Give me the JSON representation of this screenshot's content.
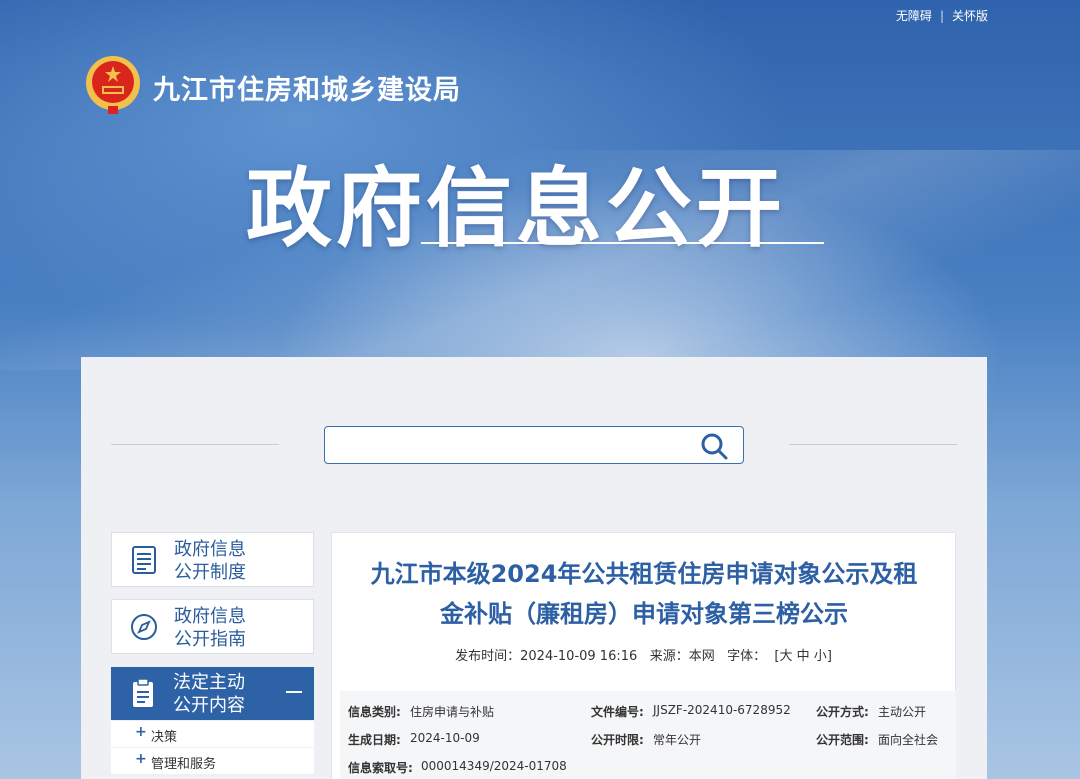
{
  "header": {
    "accessibility": "无障碍",
    "care_mode": "关怀版",
    "site_name": "九江市住房和城乡建设局",
    "hero_title": "政府信息公开"
  },
  "search": {
    "placeholder": ""
  },
  "sidebar": {
    "items": [
      {
        "label_line1": "政府信息",
        "label_line2": "公开制度",
        "icon": "document-list-icon"
      },
      {
        "label_line1": "政府信息",
        "label_line2": "公开指南",
        "icon": "compass-icon"
      },
      {
        "label_line1": "法定主动",
        "label_line2": "公开内容",
        "icon": "clipboard-icon",
        "active": true
      }
    ],
    "sub_items": [
      "决策",
      "管理和服务"
    ]
  },
  "article": {
    "title_line1": "九江市本级2024年公共租赁住房申请对象公示及租",
    "title_line2": "金补贴（廉租房）申请对象第三榜公示",
    "publish_label": "发布时间：",
    "publish_time": "2024-10-09 16:16",
    "source_label": "来源：",
    "source": "本网",
    "font_label": "字体：",
    "font_open": "[",
    "font_large": "大",
    "font_medium": "中",
    "font_small": "小",
    "font_close": "]"
  },
  "info": {
    "category_label": "信息类别:",
    "category": "住房申请与补贴",
    "doc_no_label": "文件编号:",
    "doc_no": "JJSZF-202410-6728952",
    "open_mode_label": "公开方式:",
    "open_mode": "主动公开",
    "date_label": "生成日期:",
    "date": "2024-10-09",
    "open_period_label": "公开时限:",
    "open_period": "常年公开",
    "scope_label": "公开范围:",
    "scope": "面向全社会",
    "index_label": "信息索取号:",
    "index": "000014349/2024-01708"
  },
  "colors": {
    "brand": "#2d62a6",
    "title": "#2d5fa5",
    "emblem_red": "#d9251c",
    "emblem_gold": "#f3c14b"
  }
}
